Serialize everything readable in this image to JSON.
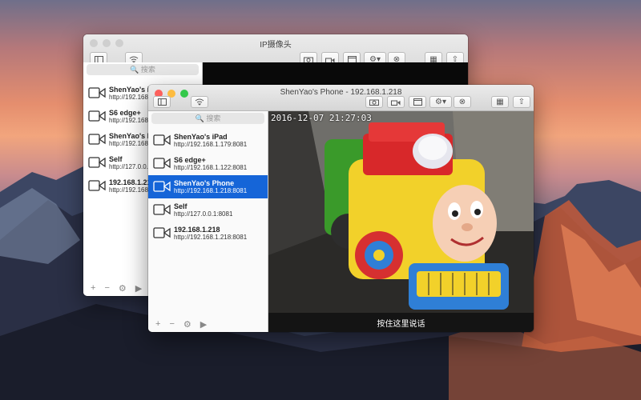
{
  "back_window": {
    "title": "IP摄像头",
    "search_placeholder": "搜索",
    "devices": [
      {
        "name": "ShenYao's iPad",
        "url": "http://192.168.1"
      },
      {
        "name": "S6 edge+",
        "url": "http://192.168.1"
      },
      {
        "name": "ShenYao's Pho",
        "url": "http://192.168.1"
      },
      {
        "name": "Self",
        "url": "http://127.0.0.1:"
      },
      {
        "name": "192.168.1.218",
        "url": "http://192.168.1"
      }
    ],
    "bottom_icons": [
      "+",
      "−",
      "⚙",
      "▶"
    ]
  },
  "front_window": {
    "title": "ShenYao's Phone - 192.168.1.218",
    "search_placeholder": "搜索",
    "selected_index": 2,
    "devices": [
      {
        "name": "ShenYao's iPad",
        "url": "http://192.168.1.179:8081"
      },
      {
        "name": "S6 edge+",
        "url": "http://192.168.1.122:8081"
      },
      {
        "name": "ShenYao's Phone",
        "url": "http://192.168.1.218:8081"
      },
      {
        "name": "Self",
        "url": "http://127.0.0.1:8081"
      },
      {
        "name": "192.168.1.218",
        "url": "http://192.168.1.218:8081"
      }
    ],
    "bottom_icons": [
      "+",
      "−",
      "⚙",
      "▶"
    ],
    "video": {
      "timestamp": "2016-12-07 21:27:03",
      "push_to_talk": "按住这里说话"
    }
  },
  "colors": {
    "close": "#fc605c",
    "minimize": "#fdbc40",
    "zoom": "#34c84a",
    "selection": "#1565d8"
  }
}
